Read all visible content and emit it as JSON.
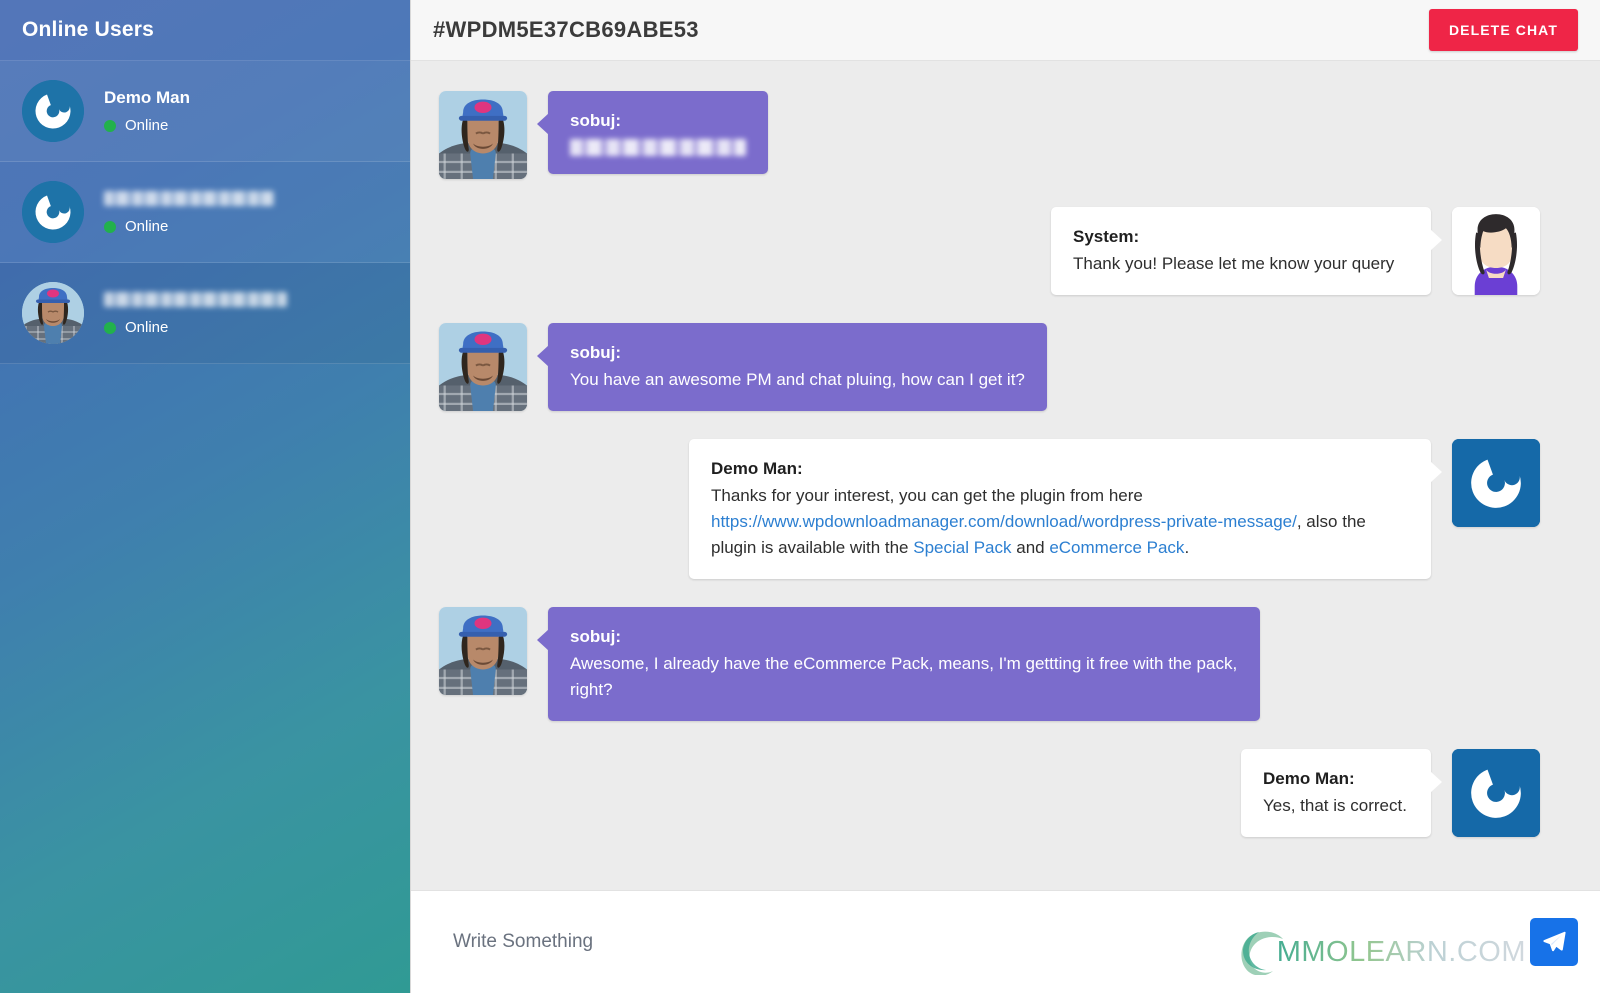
{
  "sidebar": {
    "title": "Online Users",
    "items": [
      {
        "name": "Demo Man",
        "redacted": false,
        "status": "Online",
        "avatar": "gravatar-logo-icon"
      },
      {
        "name": "",
        "redacted": true,
        "status": "Online",
        "avatar": "gravatar-logo-icon"
      },
      {
        "name": "",
        "redacted": true,
        "status": "Online",
        "avatar": "user-photo"
      }
    ]
  },
  "header": {
    "chat_id": "#WPDM5E37CB69ABE53",
    "delete_label": "DELETE CHAT"
  },
  "messages": [
    {
      "side": "left",
      "sender": "sobuj:",
      "text": "",
      "redacted": true,
      "avatar": "user-photo"
    },
    {
      "side": "right",
      "sender": "System:",
      "text": "Thank you! Please let me know your query",
      "redacted": false,
      "avatar": "system-woman-avatar"
    },
    {
      "side": "left",
      "sender": "sobuj:",
      "text": "You have an awesome PM and chat pluing, how can I get it?",
      "redacted": false,
      "avatar": "user-photo"
    },
    {
      "side": "right",
      "sender": "Demo Man:",
      "text": "Thanks for your interest, you can get the plugin from here ",
      "redacted": false,
      "avatar": "gravatar-logo-icon",
      "rich": [
        {
          "t": "text",
          "v": "Thanks for your interest, you can get the plugin from here "
        },
        {
          "t": "link",
          "v": "https://www.wpdownloadmanager.com/download/wordpress-private-message/"
        },
        {
          "t": "text",
          "v": ", also the plugin is available with the "
        },
        {
          "t": "link",
          "v": "Special Pack"
        },
        {
          "t": "text",
          "v": " and "
        },
        {
          "t": "link",
          "v": "eCommerce Pack"
        },
        {
          "t": "text",
          "v": "."
        }
      ]
    },
    {
      "side": "left",
      "sender": "sobuj:",
      "text": "Awesome, I already have the eCommerce Pack, means, I'm gettting it free with the pack, right?",
      "redacted": false,
      "avatar": "user-photo"
    },
    {
      "side": "right",
      "sender": "Demo Man:",
      "text": "Yes, that is correct.",
      "redacted": false,
      "avatar": "gravatar-logo-icon"
    }
  ],
  "composer": {
    "placeholder": "Write Something",
    "value": "",
    "send_icon": "send-paper-plane-icon"
  },
  "watermark": {
    "text": "MMOLEARN.COM"
  },
  "colors": {
    "accent_purple": "#7b6ccc",
    "delete_red": "#ef2547",
    "link_blue": "#2c7fd1",
    "online_green": "#22b14c",
    "send_blue": "#1772e8",
    "sidebar_gradient_start": "#4a6fb5",
    "sidebar_gradient_end": "#309a94",
    "chat_bg": "#ececec"
  }
}
